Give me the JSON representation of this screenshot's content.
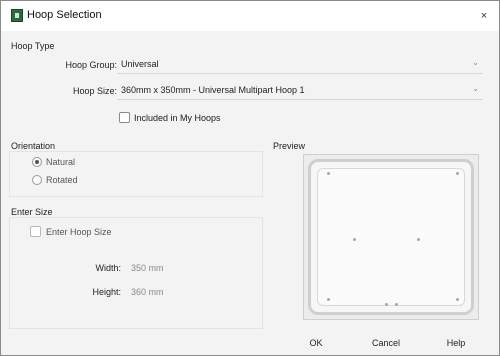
{
  "window": {
    "title": "Hoop Selection",
    "close_symbol": "×"
  },
  "hoop_type": {
    "section_label": "Hoop Type",
    "group_label": "Hoop Group:",
    "group_value": "Universal",
    "size_label": "Hoop Size:",
    "size_value": "360mm x 350mm - Universal Multipart Hoop 1",
    "included_label": "Included in My Hoops",
    "included_checked": false
  },
  "orientation": {
    "section_label": "Orientation",
    "options": [
      "Natural",
      "Rotated"
    ],
    "selected": "Natural"
  },
  "preview": {
    "section_label": "Preview"
  },
  "enter_size": {
    "section_label": "Enter Size",
    "checkbox_label": "Enter Hoop Size",
    "checkbox_checked": false,
    "width_label": "Width:",
    "width_value": "350 mm",
    "height_label": "Height:",
    "height_value": "360 mm"
  },
  "buttons": {
    "ok": "OK",
    "cancel": "Cancel",
    "help": "Help"
  },
  "icons": {
    "app": "hoop-app-icon",
    "close": "close-icon",
    "dropdown": "chevron-down-icon"
  }
}
